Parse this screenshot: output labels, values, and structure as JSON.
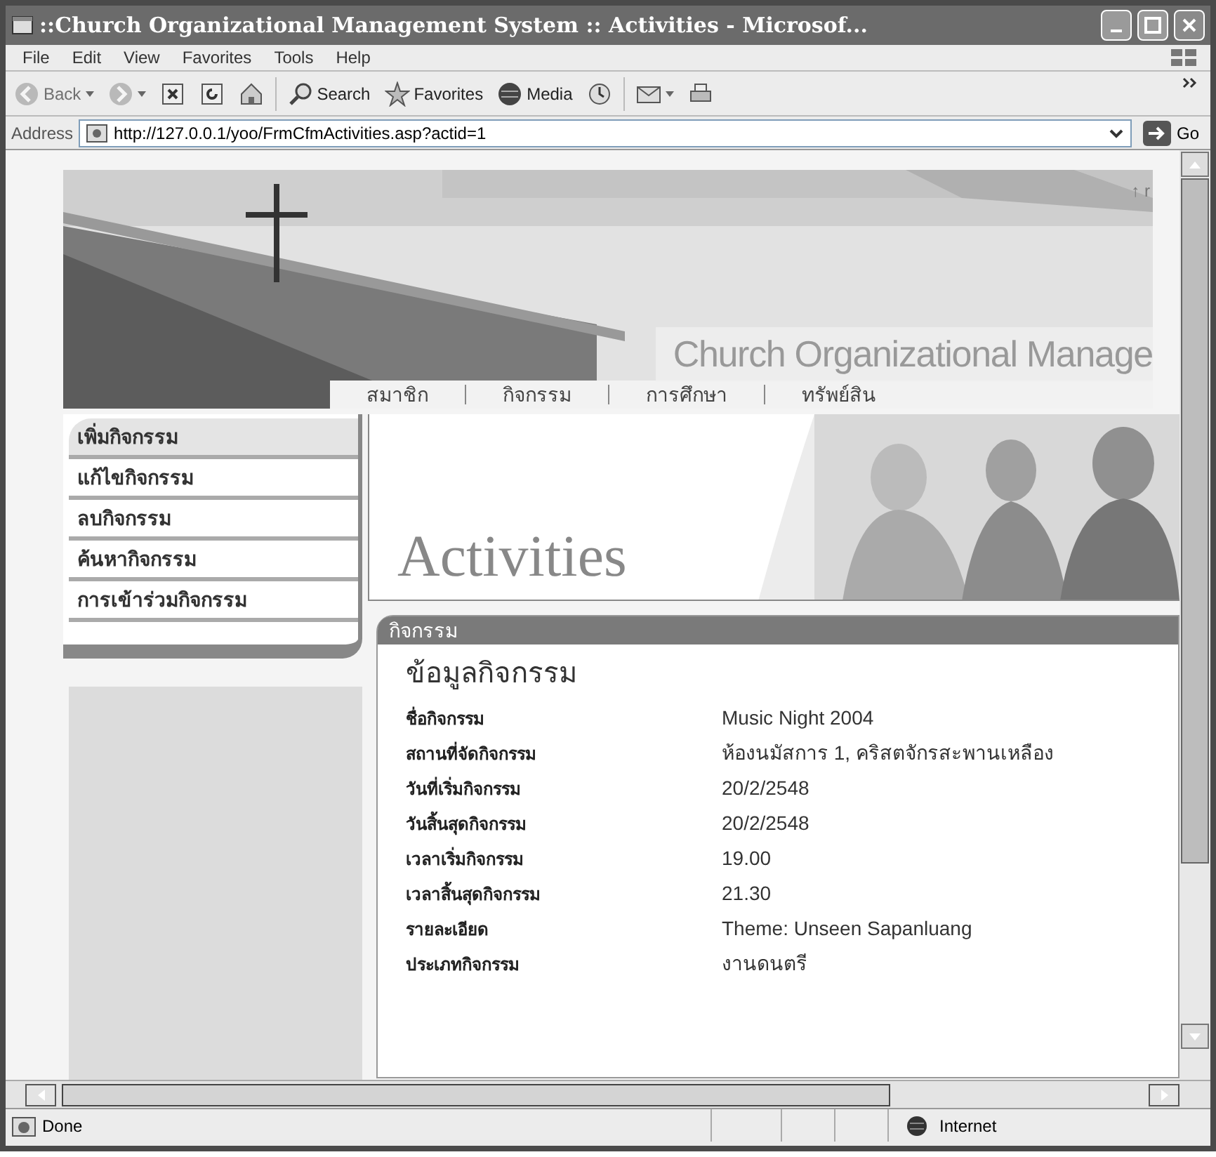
{
  "window": {
    "title": "::Church Organizational Management System :: Activities - Microsof..."
  },
  "menu": [
    "File",
    "Edit",
    "View",
    "Favorites",
    "Tools",
    "Help"
  ],
  "toolbar": [
    {
      "kind": "back",
      "label": "Back",
      "disabled": true
    },
    {
      "kind": "forward",
      "disabled": true
    },
    {
      "kind": "stop",
      "disabled": false
    },
    {
      "kind": "refresh",
      "disabled": false
    },
    {
      "kind": "home",
      "disabled": false
    },
    {
      "kind": "search",
      "label": "Search",
      "disabled": false
    },
    {
      "kind": "favorites",
      "label": "Favorites",
      "disabled": false
    },
    {
      "kind": "media",
      "label": "Media",
      "disabled": false
    },
    {
      "kind": "history",
      "disabled": false
    },
    {
      "kind": "mail",
      "disabled": false
    },
    {
      "kind": "print",
      "disabled": false
    }
  ],
  "address": {
    "label": "Address",
    "value": "http://127.0.0.1/yoo/FrmCfmActivities.asp?actid=1",
    "go": "Go"
  },
  "page": {
    "corner_text": "↑ r",
    "site_title": "Church Organizational Manage",
    "nav": [
      "สมาชิก",
      "กิจกรรม",
      "การศึกษา",
      "ทรัพย์สิน"
    ],
    "sidebar": [
      {
        "label": "เพิ่มกิจกรรม",
        "selected": true
      },
      {
        "label": "แก้ไขกิจกรรม",
        "selected": false
      },
      {
        "label": "ลบกิจกรรม",
        "selected": false
      },
      {
        "label": "ค้นหากิจกรรม",
        "selected": false
      },
      {
        "label": "การเข้าร่วมกิจกรรม",
        "selected": false
      }
    ],
    "hero_title": "Activities",
    "panel": {
      "tab": "กิจกรรม",
      "heading": "ข้อมูลกิจกรรม",
      "fields": [
        {
          "label": "ชื่อกิจกรรม",
          "value": "Music Night 2004"
        },
        {
          "label": "สถานที่จัดกิจกรรม",
          "value": "ห้องนมัสการ 1, คริสตจักรสะพานเหลือง"
        },
        {
          "label": "วันที่เริ่มกิจกรรม",
          "value": "20/2/2548"
        },
        {
          "label": "วันสิ้นสุดกิจกรรม",
          "value": "20/2/2548"
        },
        {
          "label": "เวลาเริ่มกิจกรรม",
          "value": "19.00"
        },
        {
          "label": "เวลาสิ้นสุดกิจกรรม",
          "value": "21.30"
        },
        {
          "label": "รายละเอียด",
          "value": "Theme: Unseen Sapanluang"
        },
        {
          "label": "ประเภทกิจกรรม",
          "value": "งานดนตรี"
        }
      ]
    }
  },
  "status_bar": {
    "text": "Done",
    "zone": "Internet"
  }
}
